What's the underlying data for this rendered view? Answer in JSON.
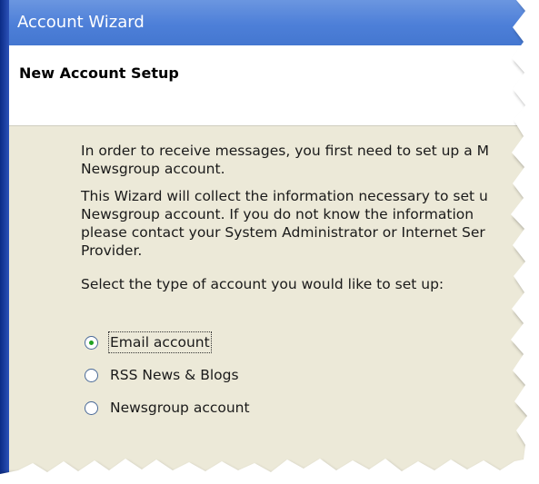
{
  "window": {
    "title": "Account Wizard"
  },
  "header": {
    "title": "New Account Setup"
  },
  "content": {
    "paragraph1": [
      "In order to receive messages, you first need to set up a M",
      "Newsgroup account."
    ],
    "paragraph2": [
      "This Wizard will collect the information necessary to set u",
      "Newsgroup account. If you do not know the information",
      "please contact your System Administrator or Internet Ser",
      "Provider."
    ],
    "prompt": "Select the type of account you would like to set up:"
  },
  "account_types": [
    {
      "label": "Email account",
      "selected": true
    },
    {
      "label": "RSS News & Blogs",
      "selected": false
    },
    {
      "label": "Newsgroup account",
      "selected": false
    }
  ],
  "colors": {
    "titlebar": "#4d7fd8",
    "dialog_background": "#ece9d8",
    "radio_selected": "#21a121"
  }
}
